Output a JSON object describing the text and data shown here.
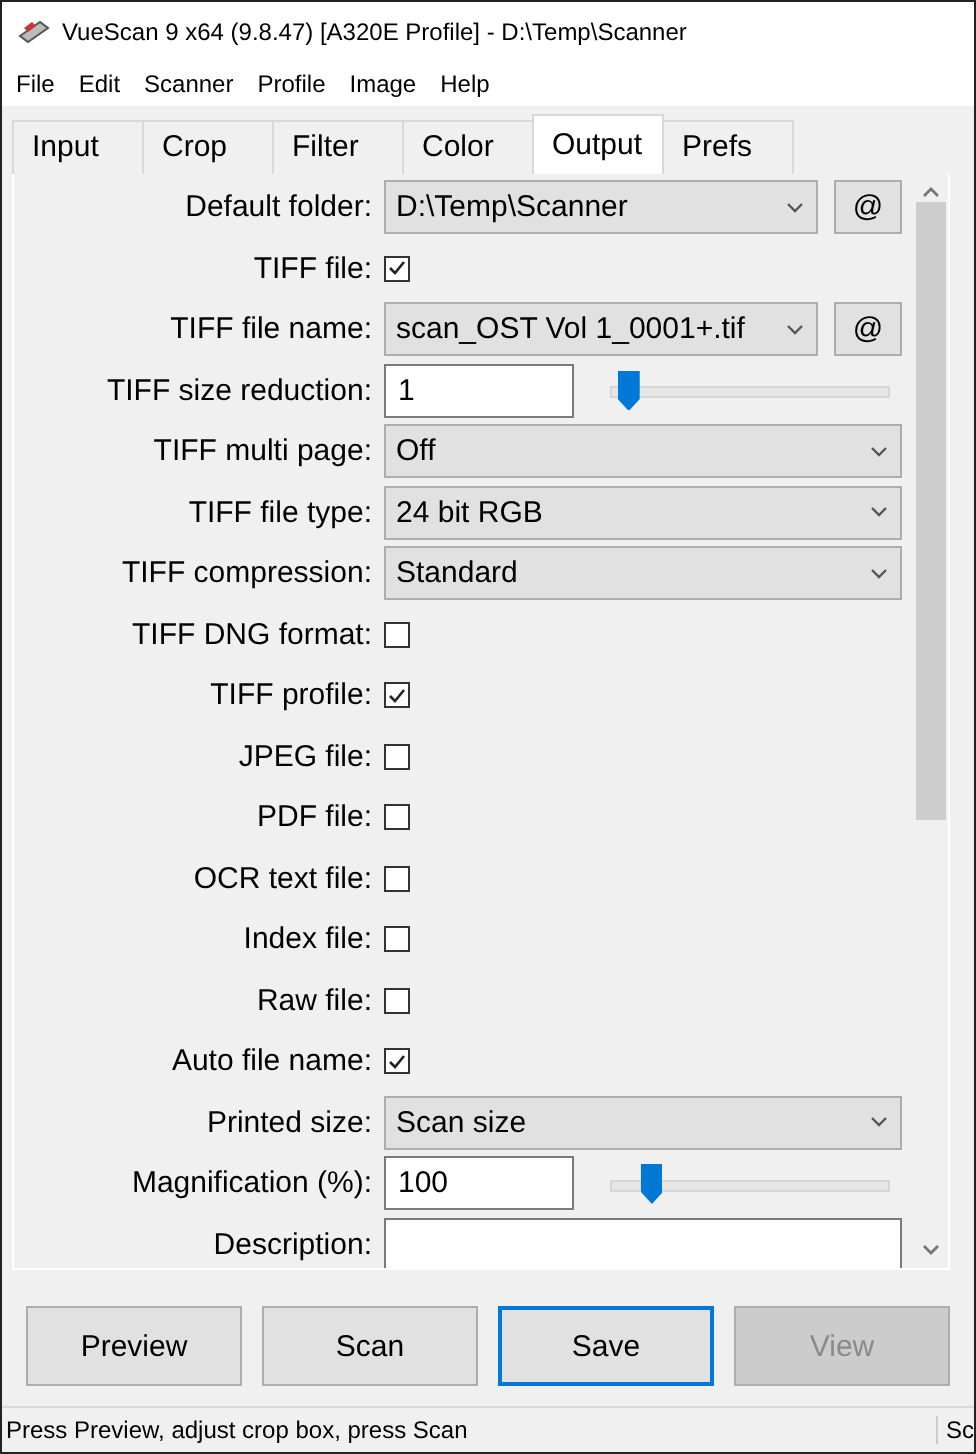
{
  "window": {
    "title": "VueScan 9 x64 (9.8.47) [A320E Profile] - D:\\Temp\\Scanner"
  },
  "menu": [
    "File",
    "Edit",
    "Scanner",
    "Profile",
    "Image",
    "Help"
  ],
  "tabs": [
    {
      "label": "Input",
      "selected": false
    },
    {
      "label": "Crop",
      "selected": false
    },
    {
      "label": "Filter",
      "selected": false
    },
    {
      "label": "Color",
      "selected": false
    },
    {
      "label": "Output",
      "selected": true
    },
    {
      "label": "Prefs",
      "selected": false
    }
  ],
  "settings": [
    {
      "kind": "combo",
      "label": "Default folder:",
      "value": "D:\\Temp\\Scanner",
      "extra": "@"
    },
    {
      "kind": "check",
      "label": "TIFF file:",
      "checked": true
    },
    {
      "kind": "combo",
      "label": "TIFF file name:",
      "value": "scan_OST Vol 1_0001+.tif",
      "extra": "@"
    },
    {
      "kind": "slider",
      "label": "TIFF size reduction:",
      "value": "1",
      "level": 0.03
    },
    {
      "kind": "combo",
      "label": "TIFF multi page:",
      "value": "Off"
    },
    {
      "kind": "combo",
      "label": "TIFF file type:",
      "value": "24 bit RGB"
    },
    {
      "kind": "combo",
      "label": "TIFF compression:",
      "value": "Standard"
    },
    {
      "kind": "check",
      "label": "TIFF DNG format:",
      "checked": false
    },
    {
      "kind": "check",
      "label": "TIFF profile:",
      "checked": true
    },
    {
      "kind": "check",
      "label": "JPEG file:",
      "checked": false
    },
    {
      "kind": "check",
      "label": "PDF file:",
      "checked": false
    },
    {
      "kind": "check",
      "label": "OCR text file:",
      "checked": false
    },
    {
      "kind": "check",
      "label": "Index file:",
      "checked": false
    },
    {
      "kind": "check",
      "label": "Raw file:",
      "checked": false
    },
    {
      "kind": "check",
      "label": "Auto file name:",
      "checked": true
    },
    {
      "kind": "combo",
      "label": "Printed size:",
      "value": "Scan size"
    },
    {
      "kind": "slider",
      "label": "Magnification (%):",
      "value": "100",
      "level": 0.12
    },
    {
      "kind": "text",
      "label": "Description:"
    }
  ],
  "buttons": [
    {
      "label": "Preview",
      "focused": false,
      "disabled": false
    },
    {
      "label": "Scan",
      "focused": false,
      "disabled": false
    },
    {
      "label": "Save",
      "focused": true,
      "disabled": false
    },
    {
      "label": "View",
      "focused": false,
      "disabled": true
    }
  ],
  "status_bar": [
    "Press Preview, adjust crop box, press Scan",
    "Sc"
  ]
}
